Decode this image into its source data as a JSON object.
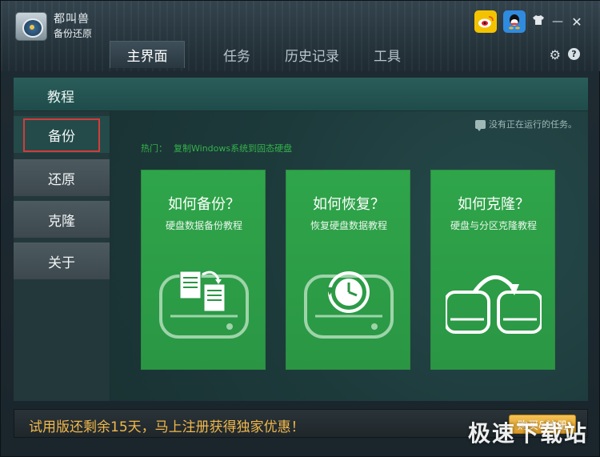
{
  "app": {
    "brand_name": "都叫兽",
    "brand_subtitle": "备份还原"
  },
  "topbar": {
    "icons": [
      "weibo-icon",
      "qq-icon",
      "tshirt-icon",
      "minimize-icon",
      "close-icon"
    ],
    "minimize_glyph": "—",
    "close_glyph": "✕",
    "skin_glyph": "👕"
  },
  "tabs": [
    {
      "label": "主界面",
      "active": true
    },
    {
      "label": "任务",
      "active": false
    },
    {
      "label": "历史记录",
      "active": false
    },
    {
      "label": "工具",
      "active": false
    }
  ],
  "header_icons": {
    "settings_glyph": "⚙",
    "help_glyph": "?"
  },
  "main": {
    "section_title": "教程",
    "sidebar": [
      {
        "label": "备份",
        "active": true
      },
      {
        "label": "还原",
        "active": false
      },
      {
        "label": "克隆",
        "active": false
      },
      {
        "label": "关于",
        "active": false
      }
    ],
    "status_text": "没有正在运行的任务。",
    "hot_label": "热门：",
    "hot_link": "复制Windows系统到固态硬盘",
    "cards": [
      {
        "title": "如何备份？",
        "subtitle": "硬盘数据备份教程",
        "icon": "backup-drive-icon"
      },
      {
        "title": "如何恢复？",
        "subtitle": "恢复硬盘数据教程",
        "icon": "restore-drive-icon"
      },
      {
        "title": "如何克隆？",
        "subtitle": "硬盘与分区克隆教程",
        "icon": "clone-drive-icon"
      }
    ]
  },
  "promo": {
    "text": "试用版还剩余15天，马上注册获得独家优惠！",
    "button_label": "购买&注册"
  },
  "watermark": "极速下载站",
  "colors": {
    "accent_green": "#2fa54a",
    "promo_orange": "#f2b84b",
    "highlight_red": "#d33b3b"
  }
}
